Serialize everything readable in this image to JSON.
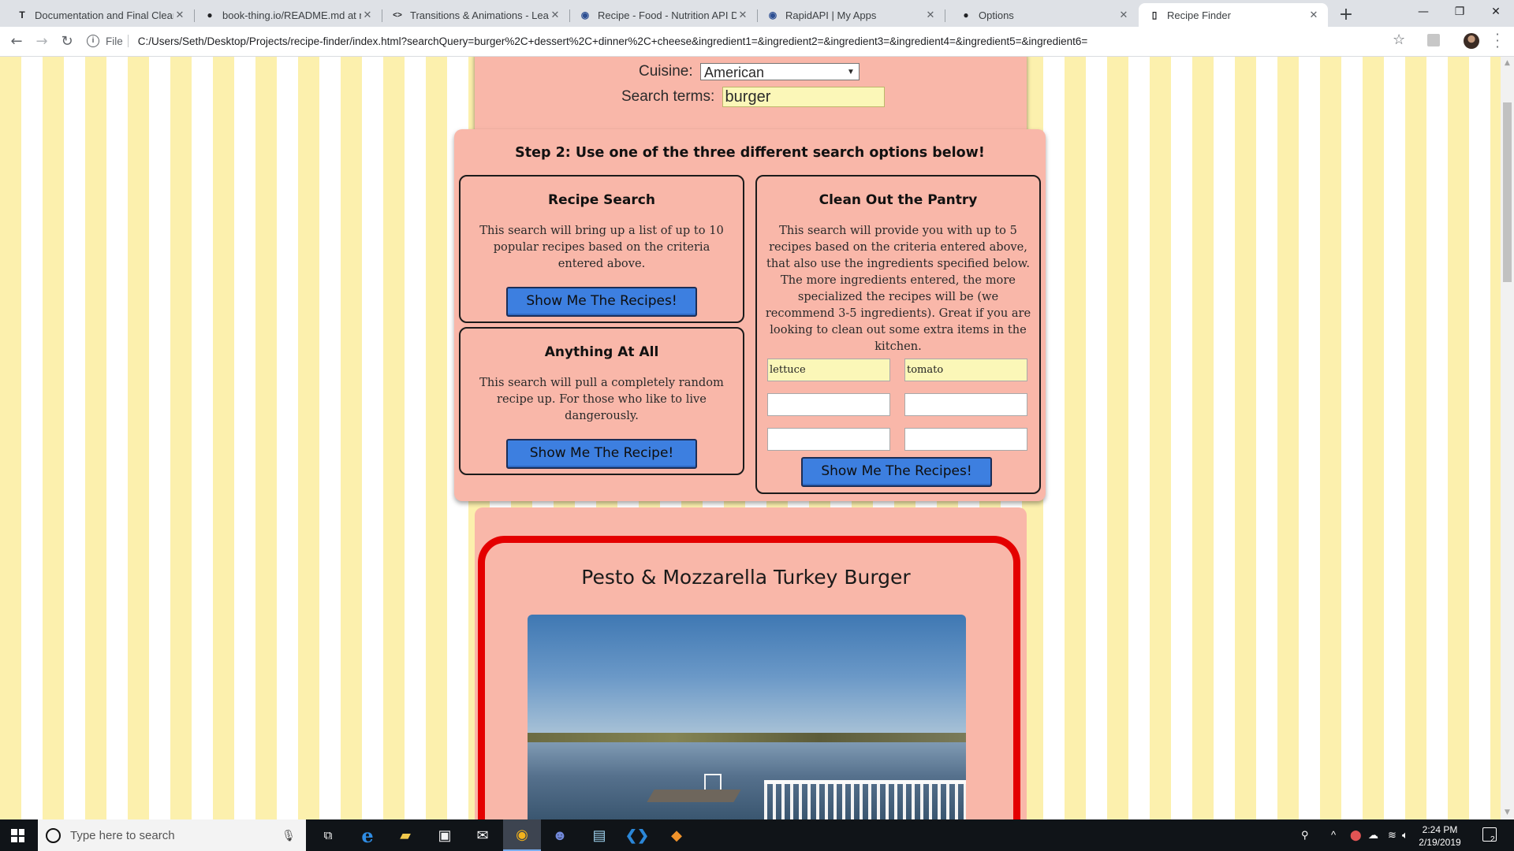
{
  "browser": {
    "tabs": [
      {
        "title": "Documentation and Final Cleanu",
        "icon": "typora-icon",
        "glyph": "T"
      },
      {
        "title": "book-thing.io/README.md at m",
        "icon": "github-icon",
        "glyph": "●"
      },
      {
        "title": "Transitions & Animations - Learn",
        "icon": "code-icon",
        "glyph": "<>"
      },
      {
        "title": "Recipe - Food - Nutrition API Do",
        "icon": "rapidapi-icon",
        "glyph": "◉"
      },
      {
        "title": "RapidAPI | My Apps",
        "icon": "rapidapi-icon",
        "glyph": "◉"
      },
      {
        "title": "Options",
        "icon": "github-icon",
        "glyph": "●"
      },
      {
        "title": "Recipe Finder",
        "icon": "page-icon",
        "glyph": "▯"
      }
    ],
    "address": {
      "scheme_label": "File",
      "url": "C:/Users/Seth/Desktop/Projects/recipe-finder/index.html?searchQuery=burger%2C+dessert%2C+dinner%2C+cheese&ingredient1=&ingredient2=&ingredient3=&ingredient4=&ingredient5=&ingredient6="
    }
  },
  "step1": {
    "cuisine_label": "Cuisine:",
    "cuisine_value": "American",
    "search_label": "Search terms:",
    "search_value": "burger"
  },
  "step2": {
    "heading": "Step 2: Use one of the three different search options below!",
    "recipe_search": {
      "title": "Recipe Search",
      "description": "This search will bring up a list of up to 10 popular recipes based on the criteria entered above.",
      "button": "Show Me The Recipes!"
    },
    "anything": {
      "title": "Anything At All",
      "description": "This search will pull a completely random recipe up. For those who like to live dangerously.",
      "button": "Show Me The Recipe!"
    },
    "pantry": {
      "title": "Clean Out the Pantry",
      "description": "This search will provide you with up to 5 recipes based on the criteria entered above, that also use the ingredients specified below. The more ingredients entered, the more specialized the recipes will be (we recommend 3-5 ingredients). Great if you are looking to clean out some extra items in the kitchen.",
      "ingredients": [
        "lettuce",
        "tomato",
        "",
        "",
        "",
        ""
      ],
      "button": "Show Me The Recipes!"
    }
  },
  "result": {
    "title": "Pesto & Mozzarella Turkey Burger"
  },
  "taskbar": {
    "search_placeholder": "Type here to search",
    "time": "2:24 PM",
    "date": "2/19/2019",
    "notification_count": "2"
  }
}
